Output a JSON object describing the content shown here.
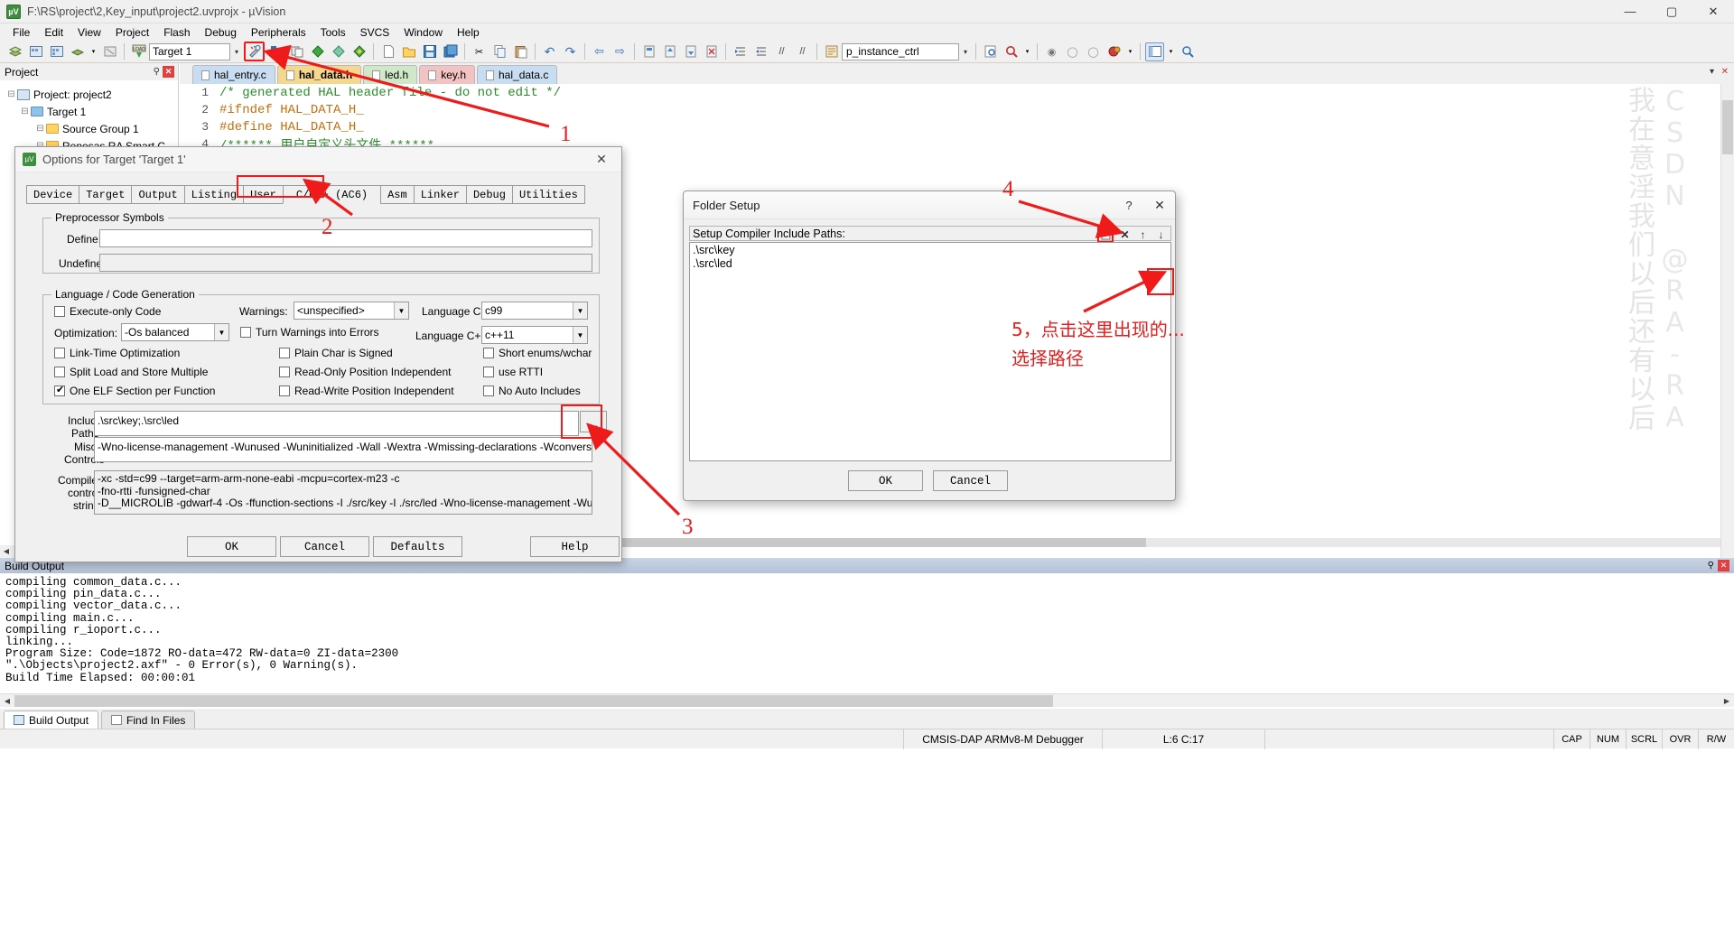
{
  "window": {
    "title": "F:\\RS\\project\\2,Key_input\\project2.uvprojx - µVision",
    "minimize": "—",
    "maximize": "▢",
    "close": "✕"
  },
  "menu": {
    "items": [
      "File",
      "Edit",
      "View",
      "Project",
      "Flash",
      "Debug",
      "Peripherals",
      "Tools",
      "SVCS",
      "Window",
      "Help"
    ]
  },
  "toolbar": {
    "target": "Target 1",
    "instance": "p_instance_ctrl",
    "dropdown_arrow": "▾"
  },
  "project_panel": {
    "title": "Project",
    "pin": "⚲",
    "close": "✕",
    "tree": [
      {
        "expander": "⊟",
        "label": "Project: project2",
        "indent": 0,
        "icon": "project-icon"
      },
      {
        "expander": "⊟",
        "label": "Target 1",
        "indent": 1,
        "icon": "folder-blue"
      },
      {
        "expander": "⊟",
        "label": "Source Group 1",
        "indent": 2,
        "icon": "folder-yellow"
      },
      {
        "expander": "⊟",
        "label": "Renesas RA Smart C",
        "indent": 2,
        "icon": "folder-yellow"
      }
    ]
  },
  "editor": {
    "tabs": [
      {
        "label": "hal_entry.c",
        "color": "#c9ddf2"
      },
      {
        "label": "hal_data.h",
        "color": "#f5d78e",
        "active": true
      },
      {
        "label": "led.h",
        "color": "#cfe8c8"
      },
      {
        "label": "key.h",
        "color": "#f3c2c2"
      },
      {
        "label": "hal_data.c",
        "color": "#c9ddf2"
      }
    ],
    "lines": [
      {
        "no": "1",
        "text": "/* generated HAL header file - do not edit */",
        "kind": "comment"
      },
      {
        "no": "2",
        "text": "#ifndef HAL_DATA_H_",
        "kind": "define"
      },
      {
        "no": "3",
        "text": "#define HAL_DATA_H_",
        "kind": "define"
      },
      {
        "no": "4",
        "text": "/****** 用户自定义头文件      ******",
        "kind": "comment"
      }
    ],
    "collapse": "▾",
    "close": "✕"
  },
  "watermark": {
    "line1": "我在意淫我们以后还有以后",
    "line2": "CSDN @RA-RA"
  },
  "options_dialog": {
    "title": "Options for Target 'Target 1'",
    "close": "✕",
    "tabs": [
      "Device",
      "Target",
      "Output",
      "Listing",
      "User",
      "C/C++ (AC6)",
      "Asm",
      "Linker",
      "Debug",
      "Utilities"
    ],
    "active_tab": "C/C++ (AC6)",
    "preprocessor": {
      "legend": "Preprocessor Symbols",
      "define_label": "Define:",
      "define_value": "",
      "undefine_label": "Undefine:",
      "undefine_value": ""
    },
    "language": {
      "legend": "Language / Code Generation",
      "checkboxes_col1": [
        {
          "label": "Execute-only Code",
          "checked": false
        },
        {
          "label": "Link-Time Optimization",
          "checked": false
        },
        {
          "label": "Split Load and Store Multiple",
          "checked": false
        },
        {
          "label": "One ELF Section per Function",
          "checked": true
        }
      ],
      "checkboxes_col2": [
        {
          "label": "Turn Warnings into Errors",
          "checked": false
        },
        {
          "label": "Plain Char is Signed",
          "checked": false
        },
        {
          "label": "Read-Only Position Independent",
          "checked": false
        },
        {
          "label": "Read-Write Position Independent",
          "checked": false
        }
      ],
      "checkboxes_col3": [
        {
          "label": "Short enums/wchar",
          "checked": false
        },
        {
          "label": "use RTTI",
          "checked": false
        },
        {
          "label": "No Auto Includes",
          "checked": false
        }
      ],
      "optimization_label": "Optimization:",
      "optimization_value": "-Os balanced",
      "warnings_label": "Warnings:",
      "warnings_value": "<unspecified>",
      "language_c_label": "Language C:",
      "language_c_value": "c99",
      "language_cpp_label": "Language C++:",
      "language_cpp_value": "c++11"
    },
    "include_paths_label_1": "Include",
    "include_paths_label_2": "Paths",
    "include_paths_value": ".\\src\\key;.\\src\\led",
    "include_browse": "...",
    "misc_label_1": "Misc",
    "misc_label_2": "Controls",
    "misc_value": "-Wno-license-management -Wunused -Wuninitialized -Wall -Wextra -Wmissing-declarations -Wconversion -Wpo",
    "compiler_label_1": "Compiler",
    "compiler_label_2": "control",
    "compiler_label_3": "string",
    "compiler_lines": [
      "-xc -std=c99 --target=arm-arm-none-eabi -mcpu=cortex-m23 -c",
      "-fno-rtti -funsigned-char",
      "-D__MICROLIB -gdwarf-4 -Os -ffunction-sections -I ./src/key -I ./src/led -Wno-license-management -Wunused"
    ],
    "buttons": {
      "ok": "OK",
      "cancel": "Cancel",
      "defaults": "Defaults",
      "help": "Help"
    }
  },
  "folder_setup": {
    "title": "Folder Setup",
    "help": "?",
    "close": "✕",
    "list_label": "Setup Compiler Include Paths:",
    "toolbar": [
      {
        "name": "new-path-icon",
        "glyph": "🗋"
      },
      {
        "name": "delete-path-icon",
        "glyph": "✕"
      },
      {
        "name": "move-up-icon",
        "glyph": "↑"
      },
      {
        "name": "move-down-icon",
        "glyph": "↓"
      }
    ],
    "paths": [
      ".\\src\\key",
      ".\\src\\led"
    ],
    "ok": "OK",
    "cancel": "Cancel"
  },
  "build_output": {
    "title": "Build Output",
    "pin": "⚲",
    "close": "✕",
    "lines": [
      "compiling common_data.c...",
      "compiling pin_data.c...",
      "compiling vector_data.c...",
      "compiling main.c...",
      "compiling r_ioport.c...",
      "linking...",
      "Program Size: Code=1872 RO-data=472 RW-data=0 ZI-data=2300",
      "\".\\Objects\\project2.axf\" - 0 Error(s), 0 Warning(s).",
      "Build Time Elapsed:  00:00:01"
    ]
  },
  "bottom_tabs": [
    {
      "label": "Build Output",
      "active": true,
      "icon": "build-icon"
    },
    {
      "label": "Find In Files",
      "active": false,
      "icon": "find-icon"
    }
  ],
  "status_bar": {
    "debugger": "CMSIS-DAP ARMv8-M Debugger",
    "position": "L:6 C:17",
    "keys": [
      "CAP",
      "NUM",
      "SCRL",
      "OVR",
      "R/W"
    ]
  },
  "annotations": {
    "numbers": [
      "1",
      "2",
      "3",
      "4",
      "5"
    ],
    "step5_line1": "5，点击这里出现的...",
    "step5_line2": "选择路径"
  },
  "colors": {
    "annotation": "#e02020",
    "accent_blue": "#b4c2d8",
    "comment_green": "#2e8b2e"
  }
}
